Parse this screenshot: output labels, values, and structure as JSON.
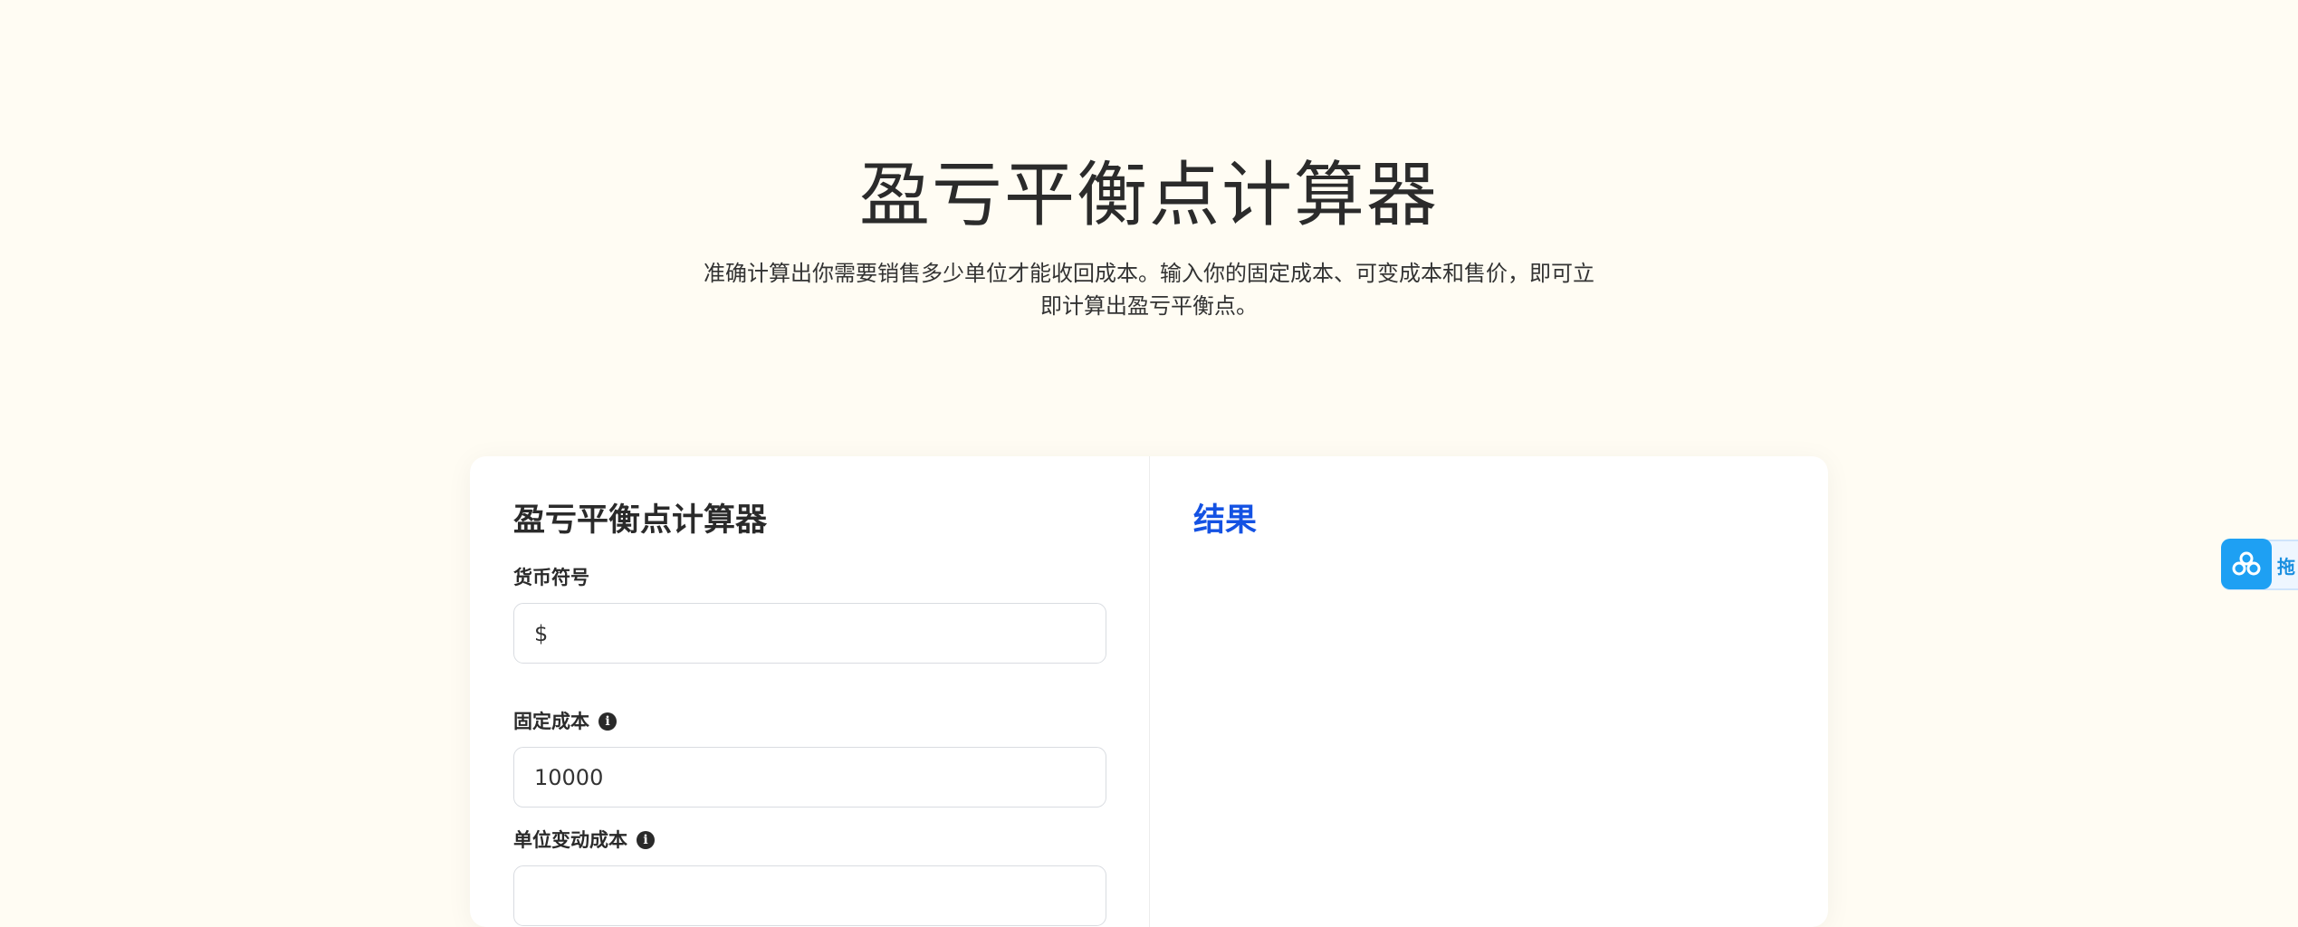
{
  "hero": {
    "title": "盈亏平衡点计算器",
    "description": "准确计算出你需要销售多少单位才能收回成本。输入你的固定成本、可变成本和售价，即可立即计算出盈亏平衡点。"
  },
  "calculator": {
    "title": "盈亏平衡点计算器",
    "currency": {
      "label": "货币符号",
      "value": "$"
    },
    "fixed_cost": {
      "label": "固定成本",
      "value": "10000"
    },
    "variable_cost": {
      "label": "单位变动成本",
      "value": ""
    }
  },
  "results": {
    "title": "结果"
  },
  "side_widget": {
    "label": "拖"
  },
  "colors": {
    "background": "#fffcf3",
    "accent": "#1452e3",
    "widget": "#1ea0f3"
  }
}
